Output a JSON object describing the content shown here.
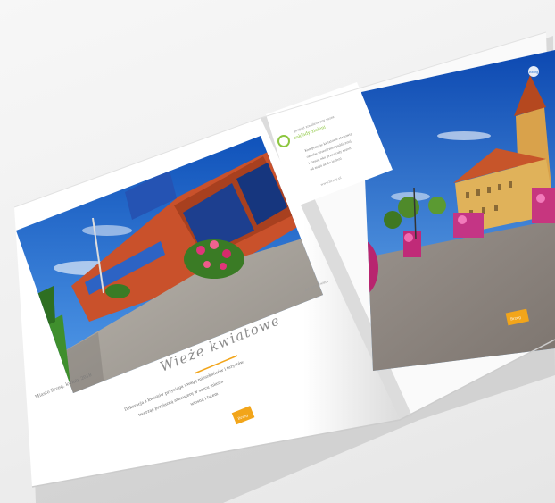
{
  "left_page": {
    "title": "Wieże kwiatowe",
    "body_line1": "Dekoracja z kwiatów przyciąga uwagę mieszkańców i turystów,",
    "body_line2": "tworząc przyjazną atmosferę w sercu miasta",
    "body_line3": "wiosną i latem",
    "photo_caption": "Miasto Brzeg, kwiaty 2018",
    "photo_credit": "fot. archiwum",
    "logo_text": "Brzeg"
  },
  "right_page": {
    "corner_logo_text": "Brzeg",
    "badge_text": "Brzeg",
    "card_header_small": "projekt zrealizowany przez",
    "card_header_brand": "zakłady zieleni",
    "card_text_lines": [
      "Kompozycje kwiatowe stanowią",
      "ozdobę przestrzeni publicznej",
      "i cieszą oko przez cały sezon",
      "od maja aż do jesieni"
    ],
    "card_footer": "www.brzeg.pl"
  },
  "colors": {
    "accent_yellow": "#f2a51a",
    "brand_green": "#8cc63f",
    "sky_blue": "#1f6fd1",
    "brick_red": "#c9512b"
  }
}
